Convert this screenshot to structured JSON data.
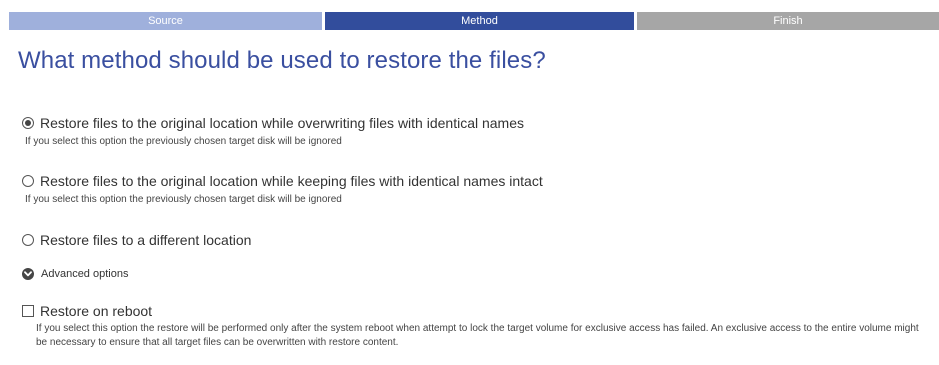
{
  "wizard_steps": [
    {
      "label": "Source",
      "state": "done"
    },
    {
      "label": "Method",
      "state": "active"
    },
    {
      "label": "Finish",
      "state": "pending"
    }
  ],
  "colors": {
    "step_done": "#9fb0dc",
    "step_active": "#324d9c",
    "step_pending": "#a6a6a6",
    "title": "#3a4fa0"
  },
  "page_title": "What method should be used to restore the files?",
  "options": [
    {
      "label": "Restore files to the original location while overwriting files with identical names",
      "description": "If you select this option the previously chosen target disk will be ignored",
      "selected": true
    },
    {
      "label": "Restore files to the original location while keeping files with identical names intact",
      "description": "If you select this option the previously chosen target disk will be ignored",
      "selected": false
    },
    {
      "label": "Restore files to a different location",
      "description": "",
      "selected": false
    }
  ],
  "advanced": {
    "label": "Advanced options",
    "icon": "chevron-down-circle-icon"
  },
  "restore_on_reboot": {
    "label": "Restore on reboot",
    "checked": false,
    "description": "If you select this option the restore will be performed only after the system reboot when attempt to lock the target volume for exclusive access has failed. An exclusive access to the entire volume might be necessary to ensure that all target files can be overwritten with restore content."
  }
}
